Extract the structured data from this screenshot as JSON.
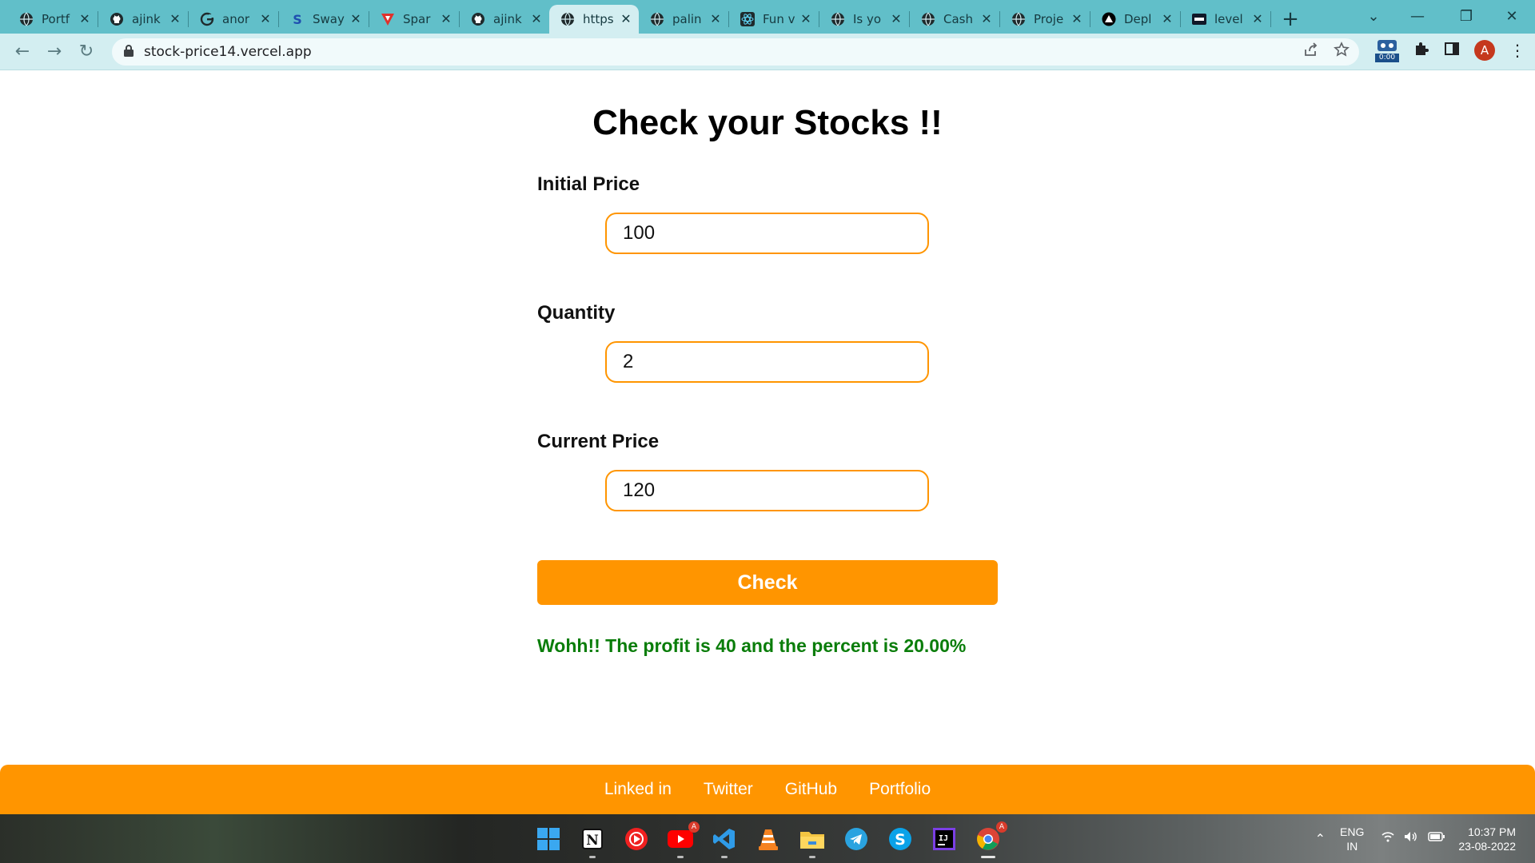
{
  "browser": {
    "tabs": [
      {
        "title": "Portf",
        "icon": "globe-icon"
      },
      {
        "title": "ajink",
        "icon": "github-icon"
      },
      {
        "title": "anor",
        "icon": "google-icon"
      },
      {
        "title": "Sway",
        "icon": "sway-icon"
      },
      {
        "title": "Spar",
        "icon": "spar-icon"
      },
      {
        "title": "ajink",
        "icon": "github-icon"
      },
      {
        "title": "https",
        "icon": "globe-icon",
        "active": true
      },
      {
        "title": "palin",
        "icon": "globe-icon"
      },
      {
        "title": "Fun v",
        "icon": "react-icon"
      },
      {
        "title": "Is yo",
        "icon": "globe-icon"
      },
      {
        "title": "Cash",
        "icon": "globe-icon"
      },
      {
        "title": "Proje",
        "icon": "globe-icon"
      },
      {
        "title": "Depl",
        "icon": "vercel-icon"
      },
      {
        "title": "level",
        "icon": "neog-icon"
      }
    ],
    "url": "stock-price14.vercel.app",
    "extension_badge": "0:00",
    "profile_initial": "A"
  },
  "page": {
    "heading": "Check your Stocks !!",
    "fields": [
      {
        "label": "Initial Price",
        "value": "100"
      },
      {
        "label": "Quantity",
        "value": "2"
      },
      {
        "label": "Current Price",
        "value": "120"
      }
    ],
    "check_label": "Check",
    "result": "Wohh!! The profit is 40 and the percent is 20.00%",
    "result_color": "#0a7d0a",
    "accent_color": "#ff9500",
    "footer_links": [
      "Linked in",
      "Twitter",
      "GitHub",
      "Portfolio"
    ]
  },
  "taskbar": {
    "apps": [
      "windows-start-icon",
      "notion-icon",
      "youtube-music-icon",
      "youtube-icon",
      "vscode-icon",
      "vlc-icon",
      "file-explorer-icon",
      "telegram-icon",
      "skype-icon",
      "intellij-icon",
      "chrome-icon"
    ],
    "lang_line1": "ENG",
    "lang_line2": "IN",
    "time": "10:37 PM",
    "date": "23-08-2022"
  }
}
